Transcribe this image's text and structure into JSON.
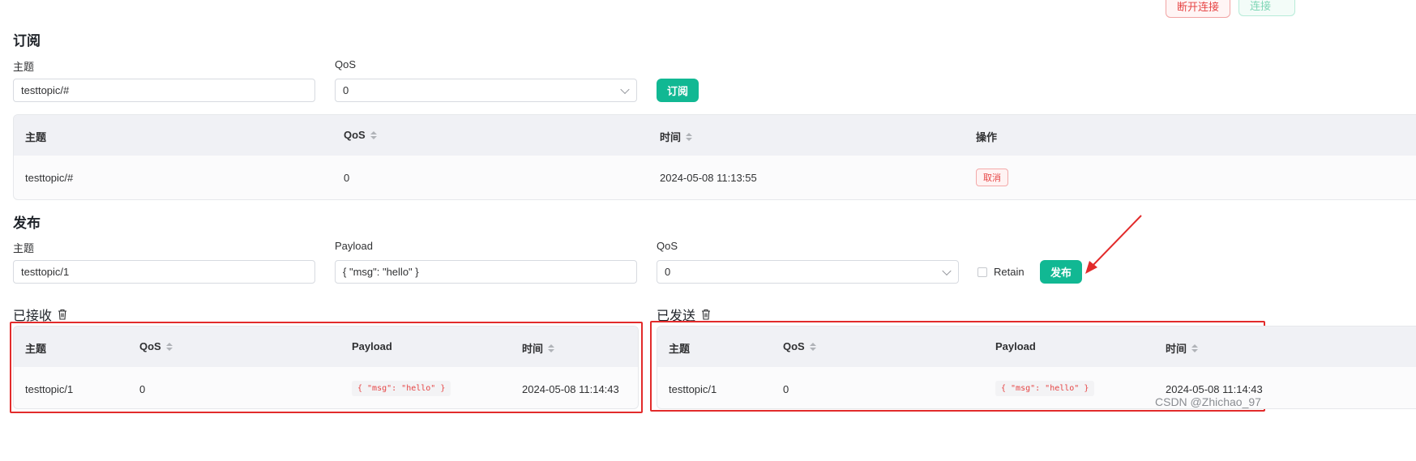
{
  "header": {
    "disconnect_label": "断开连接",
    "connect_label": "连接"
  },
  "subscribe": {
    "title": "订阅",
    "topic_label": "主题",
    "topic_value": "testtopic/#",
    "qos_label": "QoS",
    "qos_value": "0",
    "subscribe_button": "订阅",
    "table": {
      "headers": [
        "主题",
        "QoS",
        "时间",
        "操作"
      ],
      "rows": [
        {
          "topic": "testtopic/#",
          "qos": "0",
          "time": "2024-05-08 11:13:55",
          "action": "取消"
        }
      ]
    }
  },
  "publish": {
    "title": "发布",
    "topic_label": "主题",
    "topic_value": "testtopic/1",
    "payload_label": "Payload",
    "payload_value": "{ \"msg\": \"hello\" }",
    "qos_label": "QoS",
    "qos_value": "0",
    "retain_label": "Retain",
    "publish_button": "发布"
  },
  "received": {
    "title": "已接收",
    "headers": [
      "主题",
      "QoS",
      "Payload",
      "时间"
    ],
    "rows": [
      {
        "topic": "testtopic/1",
        "qos": "0",
        "payload": "{ \"msg\": \"hello\" }",
        "time": "2024-05-08 11:14:43"
      }
    ]
  },
  "sent": {
    "title": "已发送",
    "headers": [
      "主题",
      "QoS",
      "Payload",
      "时间"
    ],
    "rows": [
      {
        "topic": "testtopic/1",
        "qos": "0",
        "payload": "{ \"msg\": \"hello\" }",
        "time": "2024-05-08 11:14:43"
      }
    ]
  },
  "watermark": "CSDN @Zhichao_97",
  "colors": {
    "accent_green": "#11b893",
    "danger_red": "#e64545",
    "annotation_red": "#e22b2b"
  }
}
